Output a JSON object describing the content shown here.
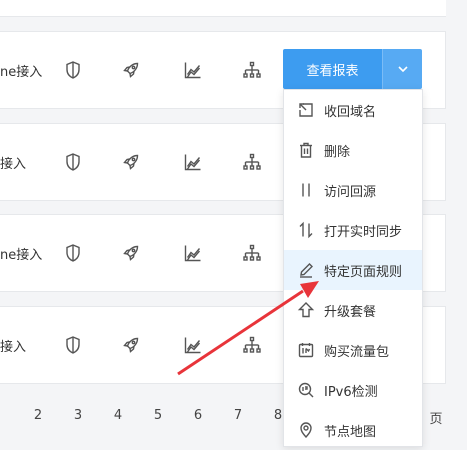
{
  "rows": [
    {
      "label": "ne接入"
    },
    {
      "label": "接入"
    },
    {
      "label": "ne接入"
    },
    {
      "label": "接入"
    }
  ],
  "row_icons": [
    "shield-icon",
    "rocket-icon",
    "trend-chart-icon",
    "sitemap-icon"
  ],
  "report_button": {
    "label": "查看报表",
    "caret": "chevron-down-icon"
  },
  "menu": {
    "items": [
      {
        "label": "收回域名",
        "icon": "reclaim-icon"
      },
      {
        "label": "删除",
        "icon": "trash-icon"
      },
      {
        "label": "访问回源",
        "icon": "origin-icon"
      },
      {
        "label": "打开实时同步",
        "icon": "sync-icon"
      },
      {
        "label": "特定页面规则",
        "icon": "pencil-icon",
        "active": true
      },
      {
        "label": "升级套餐",
        "icon": "upgrade-icon"
      },
      {
        "label": "购买流量包",
        "icon": "traffic-package-icon"
      },
      {
        "label": "IPv6检测",
        "icon": "ipv6-check-icon"
      },
      {
        "label": "节点地图",
        "icon": "location-pin-icon"
      }
    ]
  },
  "pagination": {
    "pages": [
      "2",
      "3",
      "4",
      "5",
      "6",
      "7",
      "8"
    ],
    "tail": "页"
  },
  "colors": {
    "primary": "#3d9cf0",
    "active_bg": "#e9f4fe",
    "annotation_arrow": "#e8343a"
  }
}
